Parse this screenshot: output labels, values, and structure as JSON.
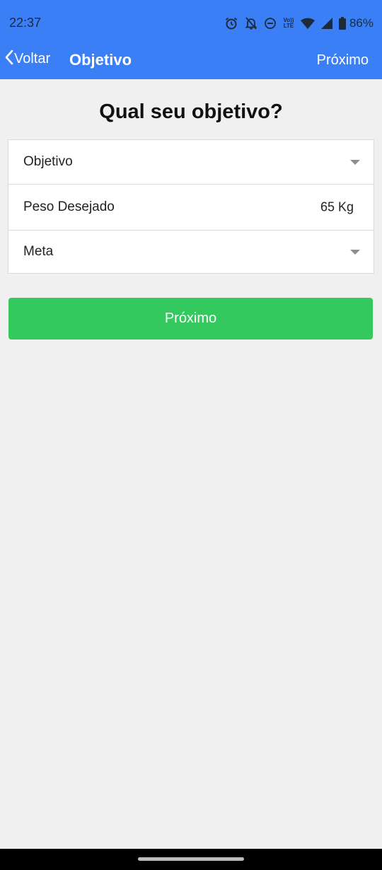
{
  "status_bar": {
    "time": "22:37",
    "volte_line1": "Vo))",
    "volte_line2": "LTE",
    "battery_percent": "86%",
    "icons": [
      "alarm-icon",
      "bell-off-icon",
      "do-not-disturb-icon",
      "volte-icon",
      "wifi-icon",
      "signal-icon",
      "battery-icon"
    ]
  },
  "nav": {
    "back_label": "Voltar",
    "title": "Objetivo",
    "next_label": "Próximo"
  },
  "page": {
    "title": "Qual seu objetivo?"
  },
  "form": {
    "objective_label": "Objetivo",
    "weight_label": "Peso Desejado",
    "weight_value": "65 Kg",
    "goal_label": "Meta"
  },
  "primary_button": {
    "label": "Próximo"
  },
  "colors": {
    "header": "#3a7ff6",
    "button": "#34c95e",
    "background": "#f0f0f0"
  }
}
